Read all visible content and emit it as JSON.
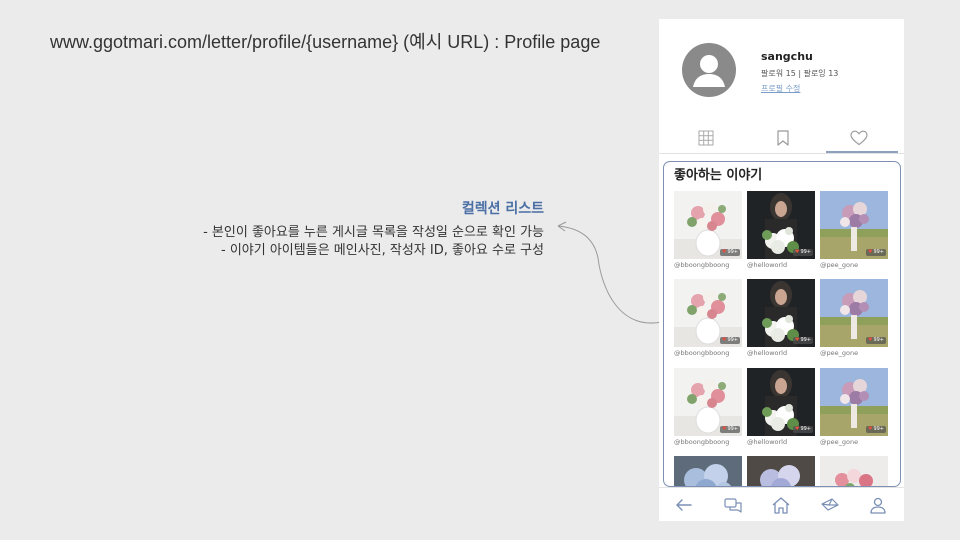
{
  "slide": {
    "title": "www.ggotmari.com/letter/profile/{username} (예시 URL) : Profile page"
  },
  "annotation": {
    "title": "컬렉션 리스트",
    "lines": [
      "- 본인이 좋아요를 누른 게시글 목록을 작성일 순으로 확인 가능",
      "- 이야기 아이템들은 메인사진, 작성자 ID, 좋아요 수로 구성"
    ]
  },
  "profile": {
    "username": "sangchu",
    "stats": "팔로워 15 | 팔로잉 13",
    "edit_label": "프로필 수정"
  },
  "tabs": [
    {
      "icon": "grid-icon",
      "active": false
    },
    {
      "icon": "bookmark-icon",
      "active": false
    },
    {
      "icon": "heart-icon",
      "active": true
    }
  ],
  "liked": {
    "title": "좋아하는 이야기",
    "rows": [
      [
        {
          "user": "@bboongbboong",
          "likes": "99+",
          "photo": "white-vase-roses"
        },
        {
          "user": "@helloworld",
          "likes": "99+",
          "photo": "woman-white-bouquet"
        },
        {
          "user": "@pee_gone",
          "likes": "99+",
          "photo": "field-bouquet"
        }
      ],
      [
        {
          "user": "@bboongbboong",
          "likes": "99+",
          "photo": "white-vase-roses"
        },
        {
          "user": "@helloworld",
          "likes": "99+",
          "photo": "woman-white-bouquet"
        },
        {
          "user": "@pee_gone",
          "likes": "99+",
          "photo": "field-bouquet"
        }
      ],
      [
        {
          "user": "@bboongbboong",
          "likes": "99+",
          "photo": "white-vase-roses"
        },
        {
          "user": "@helloworld",
          "likes": "99+",
          "photo": "woman-white-bouquet"
        },
        {
          "user": "@pee_gone",
          "likes": "99+",
          "photo": "field-bouquet"
        }
      ],
      [
        {
          "user": "",
          "likes": "",
          "photo": "hydrangea-blue"
        },
        {
          "user": "",
          "likes": "",
          "photo": "hydrangea-lavender"
        },
        {
          "user": "",
          "likes": "",
          "photo": "pink-roses"
        }
      ]
    ]
  },
  "bottom_nav": [
    "back-arrow-icon",
    "chat-icon",
    "home-icon",
    "letter-icon",
    "user-icon"
  ],
  "colors": {
    "accent": "#4a6fa5",
    "panel_border": "#7d8fb3",
    "avatar": "#8a8a8a"
  }
}
